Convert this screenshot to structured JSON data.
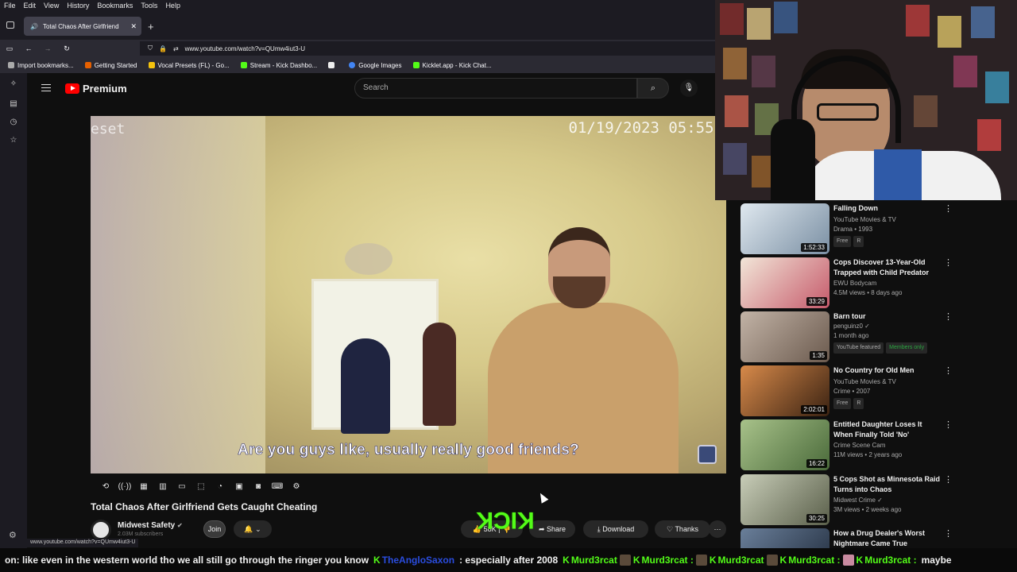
{
  "menubar": [
    "File",
    "Edit",
    "View",
    "History",
    "Bookmarks",
    "Tools",
    "Help"
  ],
  "tab": {
    "title": "Total Chaos After Girlfriend",
    "new_tab": "+"
  },
  "url": "www.youtube.com/watch?v=QUmw4iut3-U",
  "bookmarks": [
    {
      "label": "Import bookmarks...",
      "color": "#aaaaaa"
    },
    {
      "label": "Getting Started",
      "color": "#e66000"
    },
    {
      "label": "Vocal Presets (FL) - Go...",
      "color": "#f4c20d"
    },
    {
      "label": "Stream - Kick Dashbo...",
      "color": "#53fc18"
    },
    {
      "label": "",
      "color": "#eeeeee"
    },
    {
      "label": "Google Images",
      "color": "#4285f4"
    },
    {
      "label": "Kicklet.app - Kick Chat...",
      "color": "#53fc18"
    }
  ],
  "youtube": {
    "brand": "Premium",
    "search_placeholder": "Search"
  },
  "video": {
    "overlay_left": "eset",
    "timestamp": "01/19/2023  05:55:",
    "caption": "Are you guys like, usually really good friends?",
    "title": "Total Chaos After Girlfriend Gets Caught Cheating",
    "channel": "Midwest Safety",
    "subscribers": "2.03M subscribers",
    "join": "Join",
    "likes": "58K",
    "share": "Share",
    "download": "Download",
    "thanks": "Thanks",
    "more": "···"
  },
  "kick_logo": "KICK",
  "recommendations": [
    {
      "title": "Falling Down",
      "channel": "YouTube Movies & TV",
      "meta": "Drama • 1993",
      "duration": "1:52:33",
      "tags": [
        "Free",
        "R"
      ],
      "thumb": "#7a8fa3"
    },
    {
      "title": "Cops Discover 13-Year-Old Trapped with Child Predator",
      "channel": "EWU Bodycam",
      "meta": "4.5M views • 8 days ago",
      "duration": "33:29",
      "tags": [],
      "thumb": "#c65a6b"
    },
    {
      "title": "Barn tour",
      "channel": "penguinz0 ✓",
      "meta": "1 month ago",
      "duration": "1:35",
      "tags": [
        "YouTube featured",
        "Members only"
      ],
      "thumb": "#6b5a4e"
    },
    {
      "title": "No Country for Old Men",
      "channel": "YouTube Movies & TV",
      "meta": "Crime • 2007",
      "duration": "2:02:01",
      "tags": [
        "Free",
        "R"
      ],
      "thumb": "#8a4a2a"
    },
    {
      "title": "Entitled Daughter Loses It When Finally Told 'No'",
      "channel": "Crime Scene Cam",
      "meta": "11M views • 2 years ago",
      "duration": "16:22",
      "tags": [],
      "thumb": "#6f8a5a"
    },
    {
      "title": "5 Cops Shot as Minnesota Raid Turns into Chaos",
      "channel": "Midwest Crime ✓",
      "meta": "3M views • 2 weeks ago",
      "duration": "30:25",
      "tags": [],
      "thumb": "#7a7f6a"
    },
    {
      "title": "How a Drug Dealer's Worst Nightmare Came True",
      "channel": "",
      "meta": "",
      "duration": "",
      "tags": [],
      "thumb": "#3b4d6a"
    }
  ],
  "status_url": "www.youtube.com/watch?v=QUmw4iut3-U",
  "ticker": {
    "text1": "on: like even in the western world tho we all still go through the ringer you know",
    "user_blue": "TheAngloSaxon",
    "text2": ": especially after 2008",
    "user1": "Murd3rcat",
    "user2": "Murd3rcat :",
    "user3": "Murd3rcat",
    "user4": "Murd3rcat :",
    "user5": "Murd3rcat :",
    "text3": "maybe"
  }
}
